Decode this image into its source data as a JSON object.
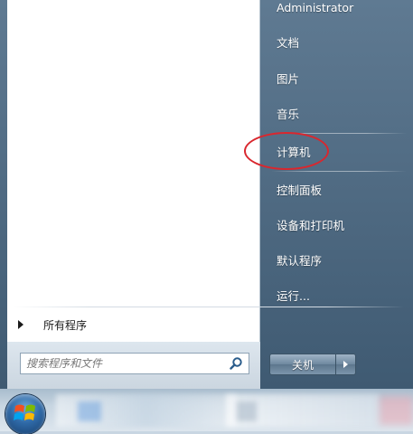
{
  "right_pane": {
    "items": [
      {
        "label": "Administrator"
      },
      {
        "label": "文档"
      },
      {
        "label": "图片"
      },
      {
        "label": "音乐"
      },
      {
        "label": "计算机"
      },
      {
        "label": "控制面板"
      },
      {
        "label": "设备和打印机"
      },
      {
        "label": "默认程序"
      },
      {
        "label": "运行..."
      }
    ]
  },
  "left_pane": {
    "all_programs_label": "所有程序"
  },
  "search": {
    "placeholder": "搜索程序和文件",
    "icon": "search-icon"
  },
  "shutdown": {
    "label": "关机",
    "arrow_icon": "chevron-right-icon"
  },
  "taskbar": {
    "start_icon": "windows-logo-icon"
  },
  "colors": {
    "highlight_ring": "#d9272e",
    "right_pane_bg": "#4f6a82",
    "left_pane_bg": "#ffffff"
  }
}
